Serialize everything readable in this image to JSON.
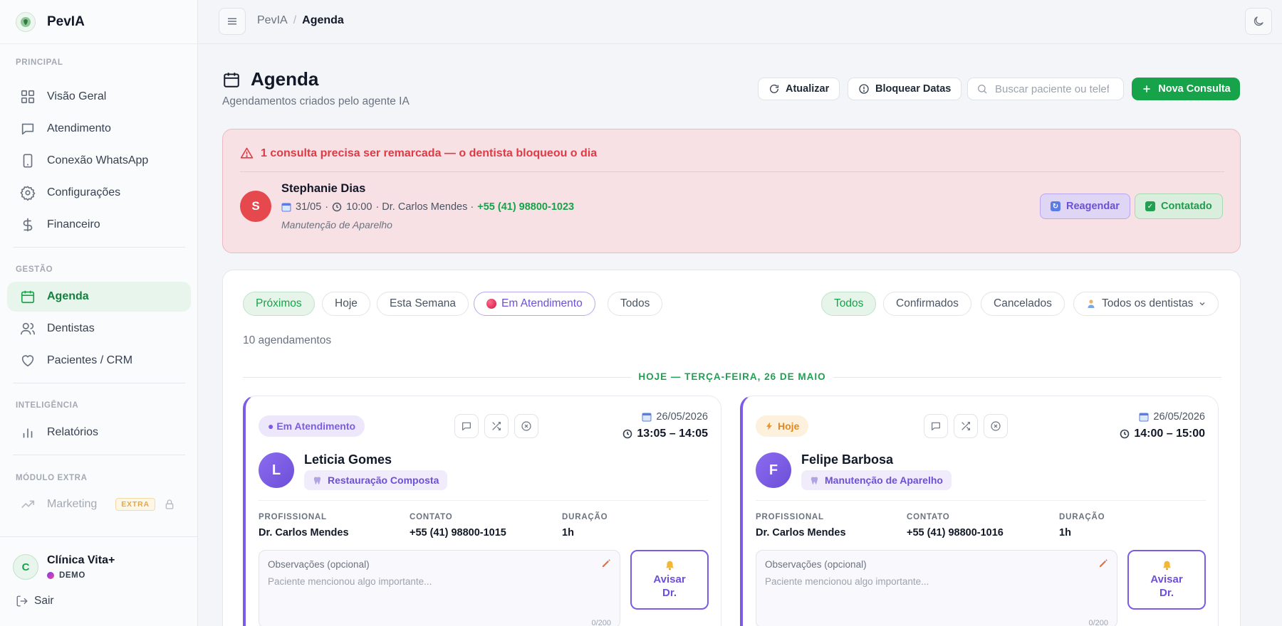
{
  "brand": {
    "name": "PevIA"
  },
  "sidebar": {
    "sections": {
      "principal": "PRINCIPAL",
      "gestao": "GESTÃO",
      "inteligencia": "INTELIGÊNCIA",
      "modulo": "MÓDULO EXTRA"
    },
    "items": {
      "visao": "Visão Geral",
      "atendimento": "Atendimento",
      "whatsapp": "Conexão WhatsApp",
      "config": "Configurações",
      "financeiro": "Financeiro",
      "agenda": "Agenda",
      "dentistas": "Dentistas",
      "pacientes": "Pacientes / CRM",
      "relatorios": "Relatórios",
      "marketing": "Marketing",
      "marketing_badge": "EXTRA"
    },
    "clinic": {
      "initial": "C",
      "name": "Clínica Vita+",
      "badge": "DEMO"
    },
    "logout": "Sair"
  },
  "topbar": {
    "crumb_root": "PevIA",
    "crumb_sep": "/",
    "crumb_current": "Agenda"
  },
  "header": {
    "title": "Agenda",
    "subtitle": "Agendamentos criados pelo agente IA",
    "refresh": "Atualizar",
    "block": "Bloquear Datas",
    "search_placeholder": "Buscar paciente ou telefone",
    "new": "Nova Consulta"
  },
  "alert": {
    "title": "1 consulta precisa ser remarcada — o dentista bloqueou o dia",
    "patient": {
      "initial": "S",
      "name": "Stephanie Dias",
      "date": "31/05",
      "sep1": "·",
      "time": "10:00",
      "doctor": "· Dr. Carlos Mendes ·",
      "phone": "+55 (41) 98800-1023",
      "procedure": "Manutenção de Aparelho"
    },
    "reschedule": "Reagendar",
    "contacted": "Contatado"
  },
  "filters": {
    "period": [
      "Próximos",
      "Hoje",
      "Esta Semana",
      "Em Atendimento",
      "Todos"
    ],
    "status": [
      "Todos",
      "Confirmados",
      "Cancelados"
    ],
    "dentist": "Todos os dentistas"
  },
  "count": "10 agendamentos",
  "day_label": "HOJE — TERÇA-FEIRA, 26 DE MAIO",
  "field_labels": {
    "prof": "PROFISSIONAL",
    "contact": "CONTATO",
    "duration": "DURAÇÃO",
    "obs": "Observações (opcional)",
    "obs_placeholder": "Paciente mencionou algo importante...",
    "obs_count": "0/200",
    "notify_1": "Avisar",
    "notify_2": "Dr."
  },
  "cards": [
    {
      "status": "● Em Atendimento",
      "date": "26/05/2026",
      "time": "13:05 – 14:05",
      "initial": "L",
      "name": "Leticia Gomes",
      "procedure": "Restauração Composta",
      "professional": "Dr. Carlos Mendes",
      "contact": "+55 (41) 98800-1015",
      "duration": "1h"
    },
    {
      "status": "Hoje",
      "date": "26/05/2026",
      "time": "14:00 – 15:00",
      "initial": "F",
      "name": "Felipe Barbosa",
      "procedure": "Manutenção de Aparelho",
      "professional": "Dr. Carlos Mendes",
      "contact": "+55 (41) 98800-1016",
      "duration": "1h"
    }
  ]
}
